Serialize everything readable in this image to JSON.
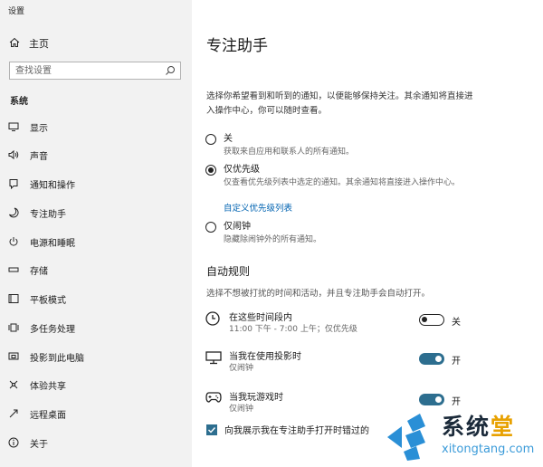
{
  "window_title": "设置",
  "sidebar": {
    "home_label": "主页",
    "search_placeholder": "查找设置",
    "section_label": "系统",
    "items": [
      {
        "label": "显示",
        "icon": "monitor-icon"
      },
      {
        "label": "声音",
        "icon": "speaker-icon"
      },
      {
        "label": "通知和操作",
        "icon": "notification-icon"
      },
      {
        "label": "专注助手",
        "icon": "moon-icon",
        "selected": true
      },
      {
        "label": "电源和睡眠",
        "icon": "power-icon"
      },
      {
        "label": "存储",
        "icon": "storage-icon"
      },
      {
        "label": "平板模式",
        "icon": "tablet-icon"
      },
      {
        "label": "多任务处理",
        "icon": "multitask-icon"
      },
      {
        "label": "投影到此电脑",
        "icon": "project-icon"
      },
      {
        "label": "体验共享",
        "icon": "share-icon"
      },
      {
        "label": "远程桌面",
        "icon": "remote-icon"
      },
      {
        "label": "关于",
        "icon": "info-icon"
      }
    ]
  },
  "main": {
    "title": "专注助手",
    "description": "选择你希望看到和听到的通知，以便能够保持关注。其余通知将直接进入操作中心，你可以随时查看。",
    "options": [
      {
        "label": "关",
        "desc": "获取来自应用和联系人的所有通知。",
        "selected": false
      },
      {
        "label": "仅优先级",
        "desc": "仅查看优先级列表中选定的通知。其余通知将直接进入操作中心。",
        "selected": true
      },
      {
        "label": "仅闹钟",
        "desc": "隐藏除闹钟外的所有通知。",
        "selected": false
      }
    ],
    "priority_link": "自定义优先级列表",
    "auto_rules_title": "自动规则",
    "auto_rules_desc": "选择不想被打扰的时间和活动，并且专注助手会自动打开。",
    "rules": [
      {
        "title": "在这些时间段内",
        "sub": "11:00 下午 - 7:00 上午；仅优先级",
        "state": "关",
        "on": false,
        "icon": "clock-icon"
      },
      {
        "title": "当我在使用投影时",
        "sub": "仅闹钟",
        "state": "开",
        "on": true,
        "icon": "projector-icon"
      },
      {
        "title": "当我玩游戏时",
        "sub": "仅闹钟",
        "state": "开",
        "on": true,
        "icon": "gamepad-icon"
      }
    ],
    "checkbox_label": "向我展示我在专注助手打开时错过的内容",
    "checkbox_checked": true
  },
  "watermark": {
    "brand_a": "系统",
    "brand_b": "堂",
    "url": "xitongtang.com"
  }
}
